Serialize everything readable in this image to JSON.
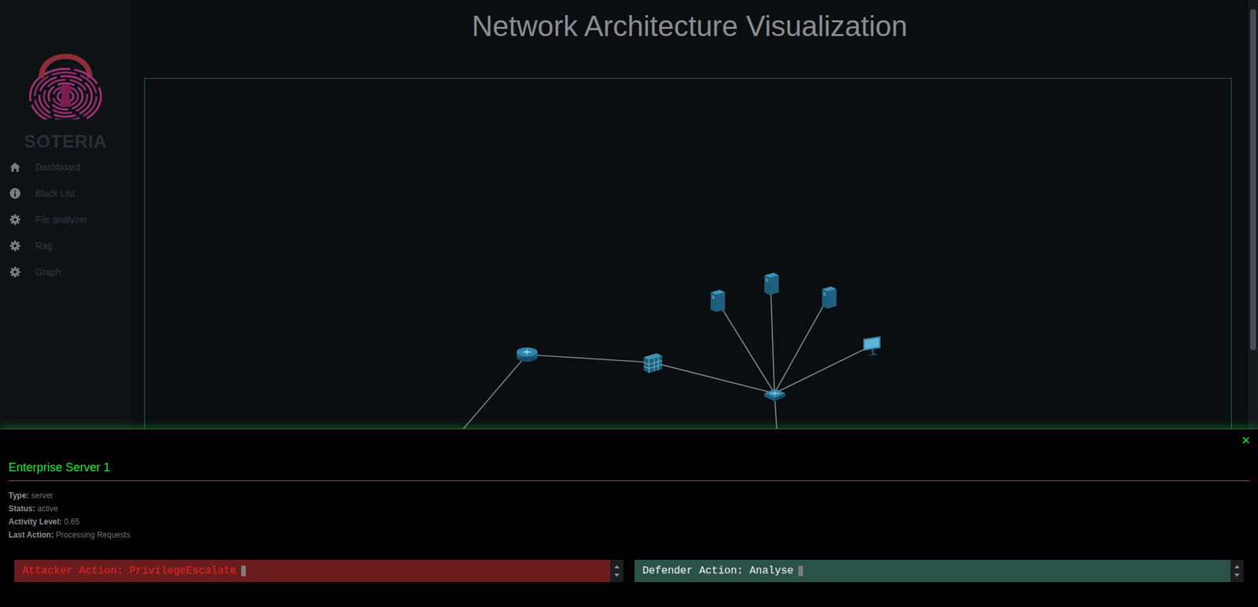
{
  "sidebar": {
    "logo_text": "SOTERIA",
    "items": [
      {
        "label": "Dashboard"
      },
      {
        "label": "Black List"
      },
      {
        "label": "File analyzer"
      },
      {
        "label": "Rag"
      },
      {
        "label": "Graph"
      }
    ]
  },
  "page": {
    "title": "Network Architecture Visualization"
  },
  "diagram": {
    "nodes": [
      {
        "kind": "router"
      },
      {
        "kind": "firewall"
      },
      {
        "kind": "switch"
      },
      {
        "kind": "server"
      },
      {
        "kind": "server"
      },
      {
        "kind": "server"
      },
      {
        "kind": "workstation"
      }
    ]
  },
  "details_panel": {
    "close": "×",
    "title": "Enterprise Server 1",
    "fields": [
      {
        "label": "Type:",
        "value": "server"
      },
      {
        "label": "Status:",
        "value": "active"
      },
      {
        "label": "Activity Level:",
        "value": "0.65"
      },
      {
        "label": "Last Action:",
        "value": "Processing Requests"
      }
    ],
    "attacker_action": "Attacker Action: PrivilegeEscalate",
    "defender_action": "Defender Action: Analyse"
  }
}
